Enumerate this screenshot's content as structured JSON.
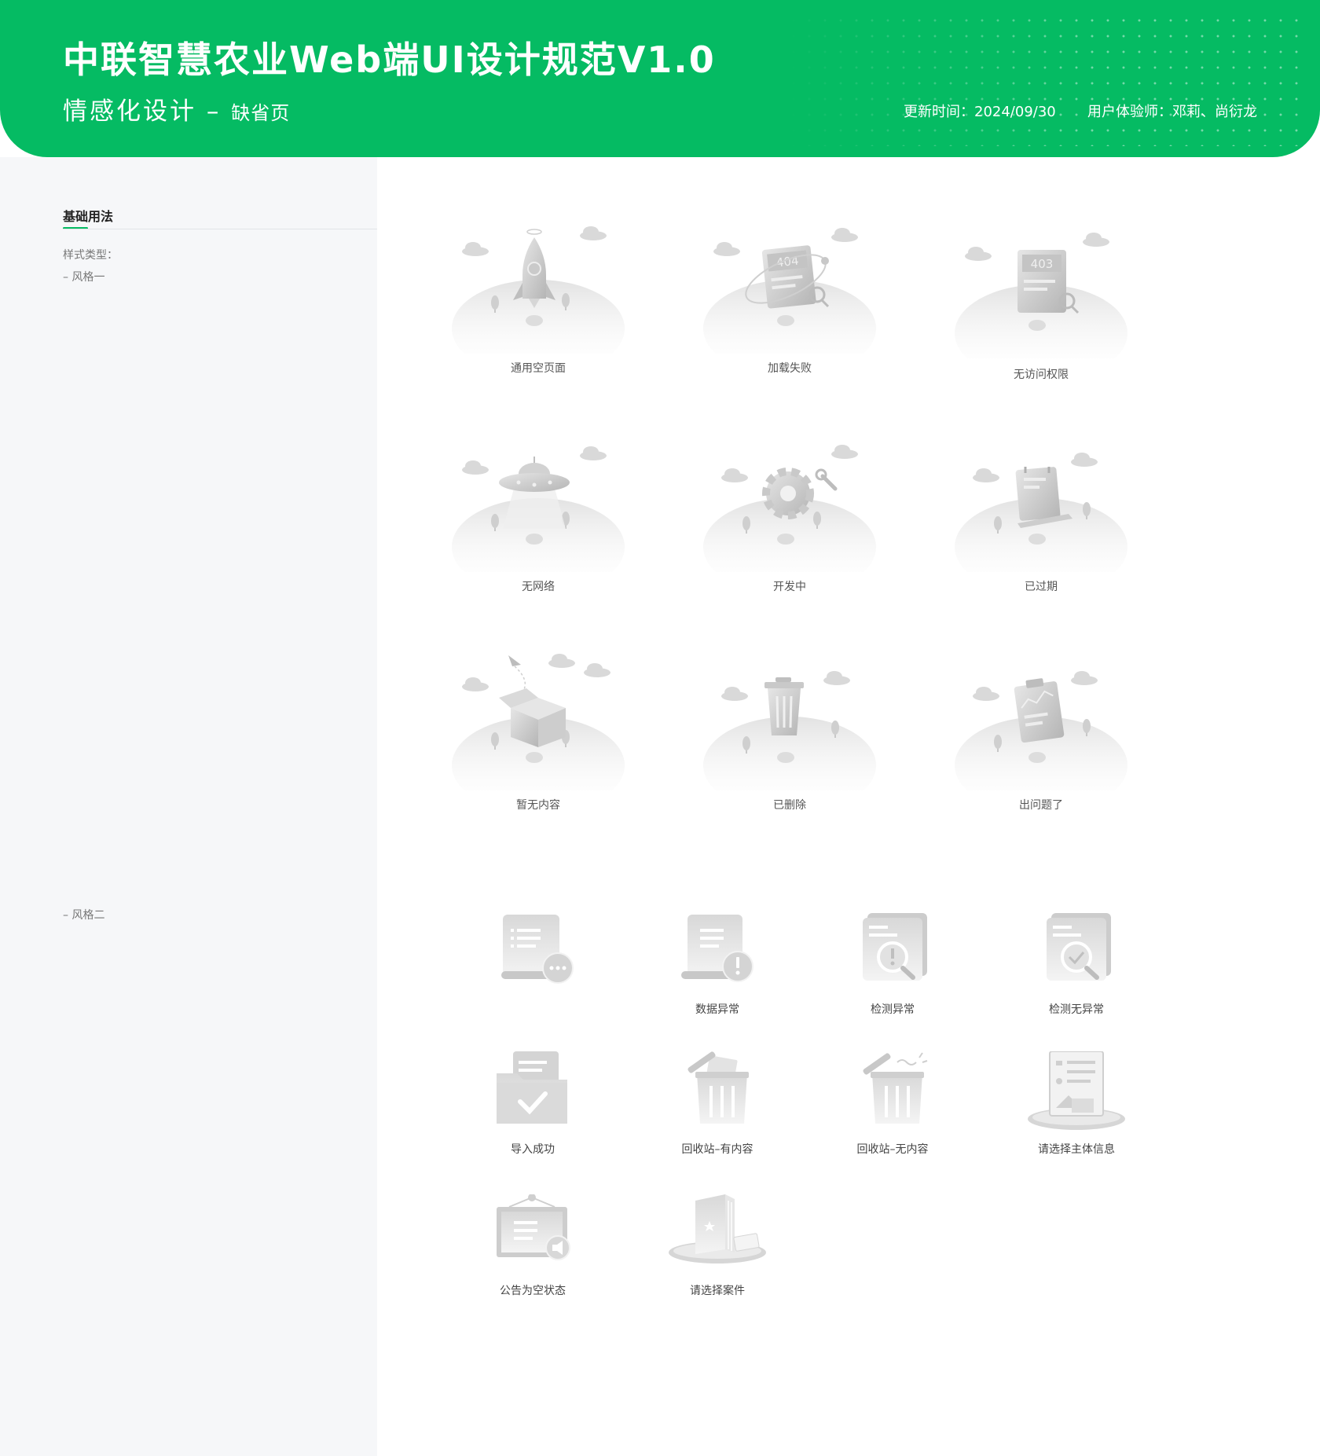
{
  "header": {
    "title": "中联智慧农业Web端UI设计规范V1.0",
    "subtitle": "情感化设计 –",
    "subtitle_secondary": "缺省页",
    "update_time": "更新时间：2024/09/30",
    "designers": "用户体验师：邓莉、尚衍龙"
  },
  "sidebar": {
    "section_title": "基础用法",
    "style_label": "样式类型：",
    "style_one": "– 风格一",
    "style_two": "– 风格二"
  },
  "style_one": [
    {
      "label": "通用空页面",
      "icon": "rocket-icon"
    },
    {
      "label": "加载失败",
      "icon": "error-404-icon",
      "badge": "404"
    },
    {
      "label": "无访问权限",
      "icon": "error-403-icon",
      "badge": "403"
    },
    {
      "label": "无网络",
      "icon": "ufo-icon"
    },
    {
      "label": "开发中",
      "icon": "gear-wrench-icon"
    },
    {
      "label": "已过期",
      "icon": "calendar-expired-icon"
    },
    {
      "label": "暂无内容",
      "icon": "open-box-icon"
    },
    {
      "label": "已删除",
      "icon": "trash-can-icon"
    },
    {
      "label": "出问题了",
      "icon": "clipboard-chart-icon"
    }
  ],
  "style_two": [
    {
      "label": "",
      "icon": "scroll-more-icon"
    },
    {
      "label": "数据异常",
      "icon": "scroll-warning-icon"
    },
    {
      "label": "检测异常",
      "icon": "inspect-warning-icon"
    },
    {
      "label": "检测无异常",
      "icon": "inspect-ok-icon"
    },
    {
      "label": "导入成功",
      "icon": "folder-check-icon"
    },
    {
      "label": "回收站–有内容",
      "icon": "recycle-bin-full-icon"
    },
    {
      "label": "回收站–无内容",
      "icon": "recycle-bin-empty-icon"
    },
    {
      "label": "请选择主体信息",
      "icon": "profile-document-icon"
    },
    {
      "label": "公告为空状态",
      "icon": "notice-board-icon"
    },
    {
      "label": "请选择案件",
      "icon": "case-file-book-icon"
    }
  ],
  "colors": {
    "brand_green": "#05BB63",
    "sidebar_bg": "#F6F7F9",
    "illustration_gray": "#C9C9C9"
  }
}
